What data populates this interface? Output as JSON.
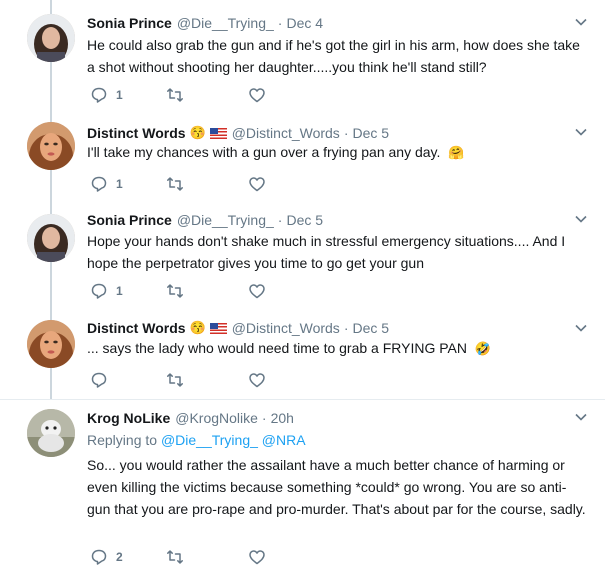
{
  "tweets": [
    {
      "name": "Sonia Prince",
      "handle": "@Die__Trying_",
      "date": "Dec 4",
      "text": "He could also grab the gun and if he's got the girl in his arm, how does she take a shot without shooting her daughter.....you think he'll stand still?",
      "reply_count": "1"
    },
    {
      "name": "Distinct Words",
      "handle": "@Distinct_Words",
      "date": "Dec 5",
      "name_emoji": "😚",
      "text": "I'll take my chances with a gun over a frying pan any day.",
      "text_emoji": "🤗",
      "reply_count": "1"
    },
    {
      "name": "Sonia Prince",
      "handle": "@Die__Trying_",
      "date": "Dec 5",
      "text": "Hope your hands don't shake much in stressful emergency situations.... And I hope the perpetrator gives you time to go get your gun",
      "reply_count": "1"
    },
    {
      "name": "Distinct Words",
      "handle": "@Distinct_Words",
      "date": "Dec 5",
      "name_emoji": "😚",
      "text": "... says the lady who would need time to grab a FRYING PAN",
      "text_emoji": "🤣",
      "reply_count": ""
    },
    {
      "name": "Krog NoLike",
      "handle": "@KrogNolike",
      "date": "20h",
      "replying_prefix": "Replying to",
      "replying_to_1": "@Die__Trying_",
      "replying_to_2": "@NRA",
      "text": "So... you would rather the assailant have a much better chance of harming or even killing the victims because something *could* go wrong.  You are so anti-gun that you are pro-rape and pro-murder.  That's about par for the course, sadly.",
      "reply_count": "2"
    }
  ],
  "separator": "·",
  "colors": {
    "muted": "#657786",
    "link": "#1da1f2",
    "border": "#e6ecf0",
    "thread": "#ccd6dd"
  },
  "icons": [
    "reply-icon",
    "retweet-icon",
    "like-icon",
    "chevron-down-icon"
  ]
}
